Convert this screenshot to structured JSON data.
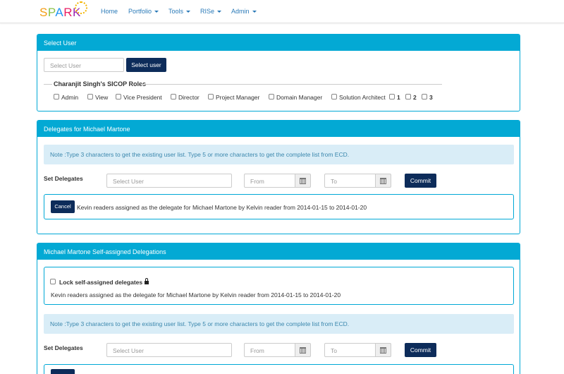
{
  "navbar": {
    "logo": "SPARK",
    "items": [
      {
        "label": "Home",
        "dropdown": false
      },
      {
        "label": "Portfolio",
        "dropdown": true
      },
      {
        "label": "Tools",
        "dropdown": true
      },
      {
        "label": "RISe",
        "dropdown": true
      },
      {
        "label": "Admin",
        "dropdown": true
      }
    ]
  },
  "select_user_panel": {
    "title": "Select User",
    "input_placeholder": "Select User",
    "button_label": "Select user",
    "roles_legend": "Charanjit Singh's SICOP Roles",
    "roles": [
      "Admin",
      "View",
      "Vice President",
      "Director",
      "Project Manager",
      "Domain Manager",
      "Solution Architect",
      "1",
      "2",
      "3"
    ]
  },
  "delegates_panel": {
    "title": "Delegates for Michael Martone",
    "note": "Note :Type 3 characters to get the existing user list. Type 5 or more characters to get the complete list from ECD.",
    "set_delegates_label": "Set Delegates",
    "user_placeholder": "Select User",
    "from_placeholder": "From",
    "to_placeholder": "To",
    "commit_label": "Commit",
    "cancel_label": "Cancel",
    "record_text": "Kevin readers assigned as the delegate for Michael Martone by Kelvin reader from 2014-01-15 to 2014-01-20"
  },
  "self_assigned_panel": {
    "title": "Michael Martone Self-assigned Delegations",
    "lock_label": "Lock self-assigned delegates",
    "record_text": "Kevin readers assigned as the delegate for Michael Martone by Kelvin reader from 2014-01-15 to 2014-01-20",
    "note": "Note :Type 3 characters to get the existing user list. Type 5 or more characters to get the complete list from ECD.",
    "set_delegates_label": "Set Delegates",
    "user_placeholder": "Select User",
    "from_placeholder": "From",
    "to_placeholder": "To",
    "commit_label": "Commit"
  },
  "colors": {
    "panel_heading": "#03a9d4",
    "navy_button": "#0d2c5a",
    "nav_link": "#2a7ab8",
    "alert_bg": "#d9edf7"
  }
}
